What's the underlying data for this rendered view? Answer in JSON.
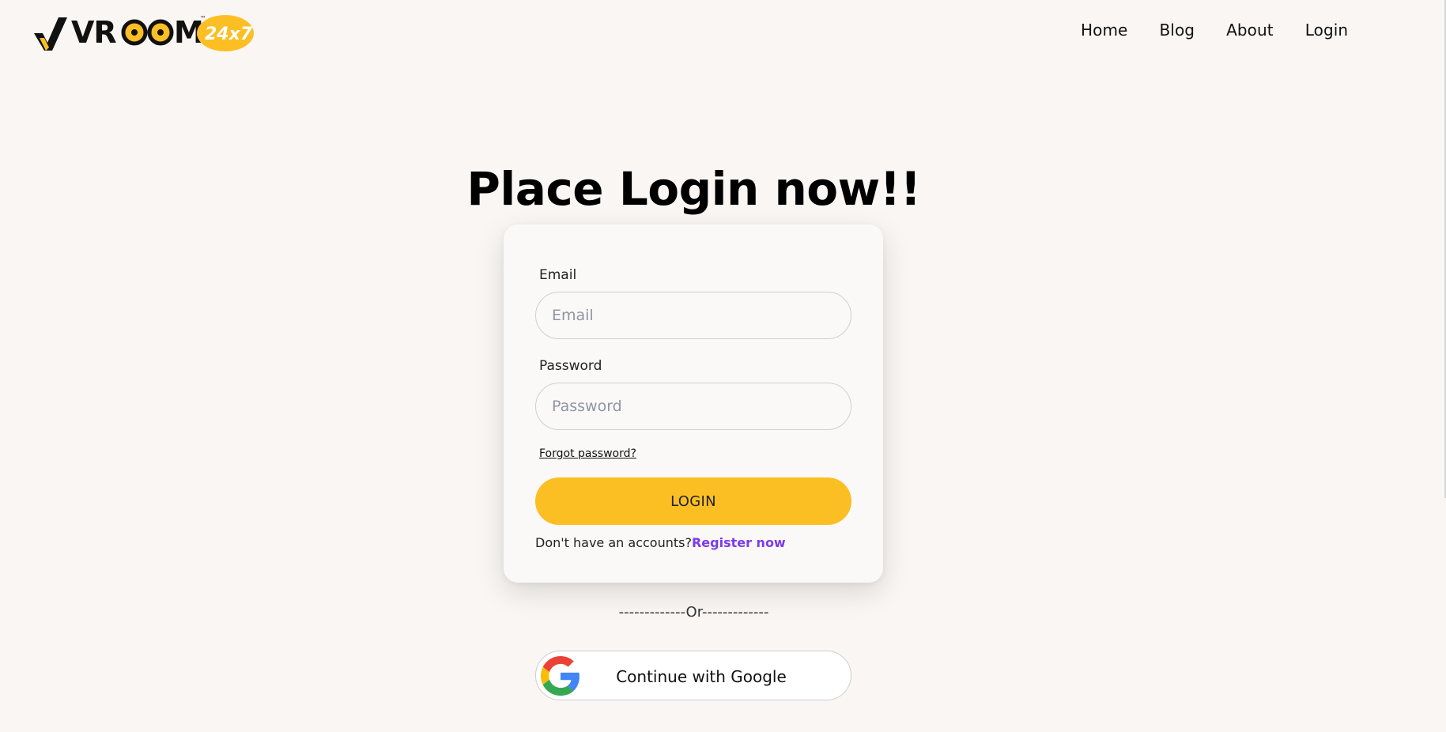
{
  "brand": {
    "name": "VROOM",
    "badge": "24x7",
    "trademark": "™",
    "accent_color": "#fbbf24",
    "mark_color": "#111111"
  },
  "nav": {
    "items": [
      {
        "label": "Home"
      },
      {
        "label": "Blog"
      },
      {
        "label": "About"
      },
      {
        "label": "Login"
      }
    ]
  },
  "heading": "Place Login now!!",
  "form": {
    "email": {
      "label": "Email",
      "placeholder": "Email",
      "value": ""
    },
    "password": {
      "label": "Password",
      "placeholder": "Password",
      "value": ""
    },
    "forgot_label": "Forgot password?",
    "submit_label": "LOGIN",
    "register_prompt": "Don't have an accounts?",
    "register_link": "Register now",
    "register_color": "#7c3aed"
  },
  "divider_text": "-------------Or-------------",
  "google": {
    "icon": "google-logo-icon",
    "label": "Continue with Google"
  }
}
